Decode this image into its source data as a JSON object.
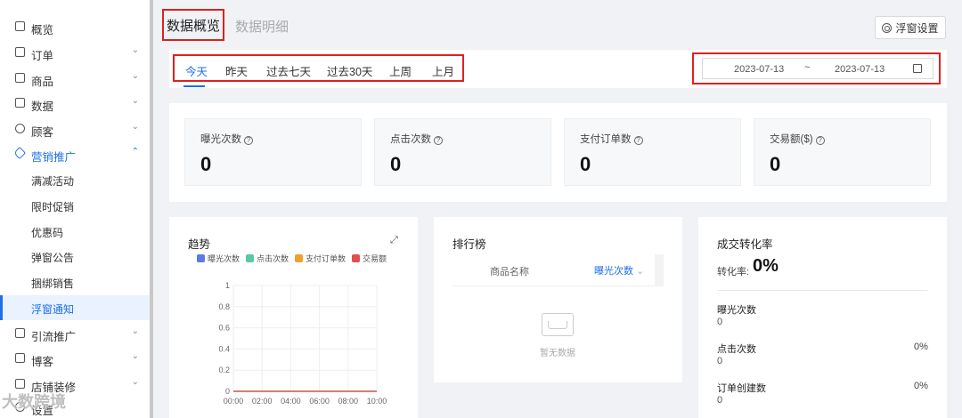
{
  "sidebar": {
    "items": [
      {
        "label": "概览",
        "chevron": ""
      },
      {
        "label": "订单",
        "chevron": "⌄"
      },
      {
        "label": "商品",
        "chevron": "⌄"
      },
      {
        "label": "数据",
        "chevron": "⌄"
      },
      {
        "label": "顾客",
        "chevron": "⌄"
      },
      {
        "label": "营销推广",
        "chevron": "⌃"
      },
      {
        "label": "引流推广",
        "chevron": "⌄"
      },
      {
        "label": "博客",
        "chevron": "⌄"
      },
      {
        "label": "店铺装修",
        "chevron": "⌄"
      },
      {
        "label": "设置",
        "chevron": ""
      }
    ],
    "sub_items": [
      {
        "label": "满减活动"
      },
      {
        "label": "限时促销"
      },
      {
        "label": "优惠码"
      },
      {
        "label": "弹窗公告"
      },
      {
        "label": "捆绑销售"
      },
      {
        "label": "浮窗通知"
      }
    ]
  },
  "header": {
    "tab_active": "数据概览",
    "tab_other": "数据明细",
    "float_settings_label": "浮窗设置"
  },
  "filter": {
    "time_tabs": [
      "今天",
      "昨天",
      "过去七天",
      "过去30天",
      "上周",
      "上月"
    ],
    "active_index": 0,
    "date_start": "2023-07-13",
    "date_sep": "~",
    "date_end": "2023-07-13"
  },
  "stats": [
    {
      "label": "曝光次数",
      "value": "0"
    },
    {
      "label": "点击次数",
      "value": "0"
    },
    {
      "label": "支付订单数",
      "value": "0"
    },
    {
      "label": "交易额($)",
      "value": "0"
    }
  ],
  "trend": {
    "title": "趋势",
    "legend": [
      {
        "name": "曝光次数",
        "color": "#5b7be0"
      },
      {
        "name": "点击次数",
        "color": "#5ac8a0"
      },
      {
        "name": "支付订单数",
        "color": "#f0a030"
      },
      {
        "name": "交易额",
        "color": "#e05050"
      }
    ]
  },
  "chart_data": {
    "type": "line",
    "x": [
      "00:00",
      "02:00",
      "04:00",
      "06:00",
      "08:00",
      "10:00"
    ],
    "y_ticks": [
      "0",
      "0.2",
      "0.4",
      "0.6",
      "0.8",
      "1"
    ],
    "ylim": [
      0,
      1
    ],
    "series": [
      {
        "name": "曝光次数",
        "values": [
          0,
          0,
          0,
          0,
          0,
          0
        ]
      },
      {
        "name": "点击次数",
        "values": [
          0,
          0,
          0,
          0,
          0,
          0
        ]
      },
      {
        "name": "支付订单数",
        "values": [
          0,
          0,
          0,
          0,
          0,
          0
        ]
      },
      {
        "name": "交易额",
        "values": [
          0,
          0,
          0,
          0,
          0,
          0
        ]
      }
    ]
  },
  "ranking": {
    "title": "排行榜",
    "col_name": "商品名称",
    "col_metric": "曝光次数",
    "sort_icon": "⌄",
    "empty_text": "暂无数据"
  },
  "conversion": {
    "title": "成交转化率",
    "rate_label": "转化率:",
    "rate_value": "0%",
    "rows": [
      {
        "label": "曝光次数",
        "value": "0",
        "pct": ""
      },
      {
        "label": "点击次数",
        "value": "0",
        "pct": "0%"
      },
      {
        "label": "订单创建数",
        "value": "0",
        "pct": "0%"
      }
    ]
  },
  "watermark": "大数跨境"
}
